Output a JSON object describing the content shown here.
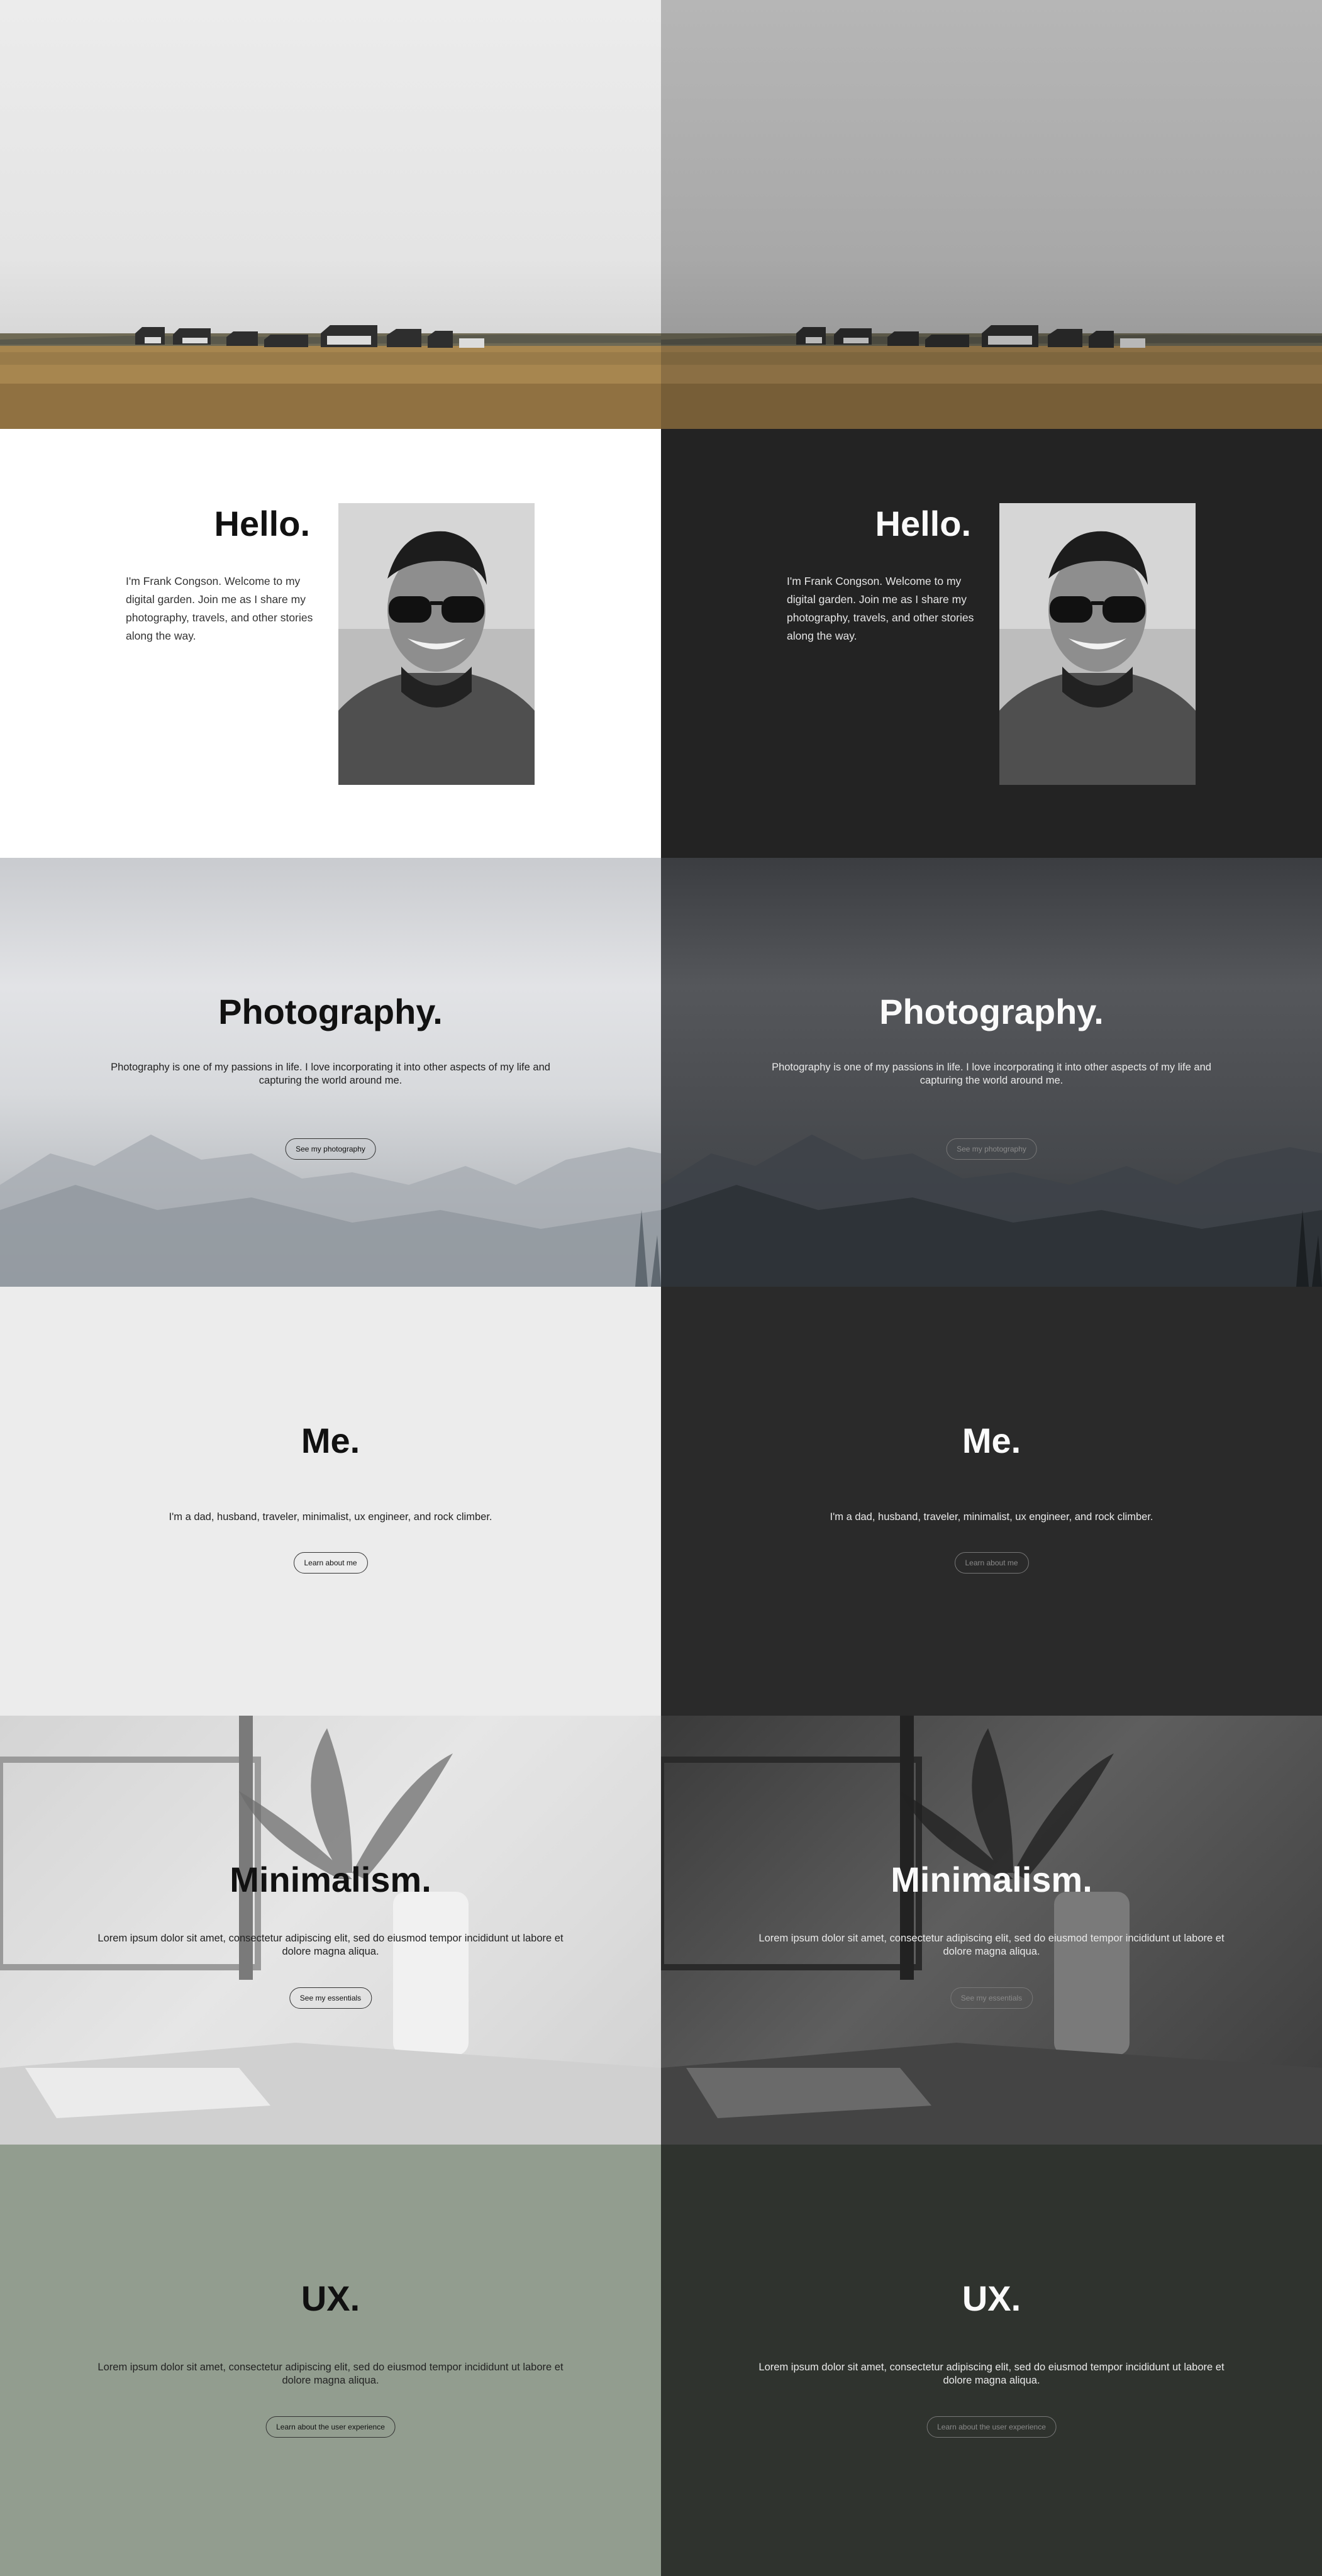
{
  "hello": {
    "title": "Hello.",
    "intro": "I'm Frank Congson. Welcome to my digital garden. Join me as I share my photography, travels, and other stories along the way."
  },
  "photography": {
    "title": "Photography.",
    "text": "Photography is one of my passions in life. I love incorporating it into other aspects of my life and capturing the world around me.",
    "button": "See my photography"
  },
  "me": {
    "title": "Me.",
    "text": "I'm a dad, husband, traveler, minimalist, ux engineer, and rock climber.",
    "button": "Learn about me"
  },
  "minimalism": {
    "title": "Minimalism.",
    "text": "Lorem ipsum dolor sit amet, consectetur adipiscing elit, sed do eiusmod tempor incididunt ut labore et dolore magna aliqua.",
    "button": "See my essentials"
  },
  "ux": {
    "title": "UX.",
    "text": "Lorem ipsum dolor sit amet, consectetur adipiscing elit, sed do eiusmod tempor incididunt ut labore et dolore magna aliqua.",
    "button": "Learn about the user experience"
  },
  "themes": {
    "light": {
      "background": "#ffffff",
      "text": "#111111",
      "ux_bg": "#929d8f"
    },
    "dark": {
      "background": "#232323",
      "text": "#fafafa",
      "ux_bg": "#2f332e"
    }
  }
}
